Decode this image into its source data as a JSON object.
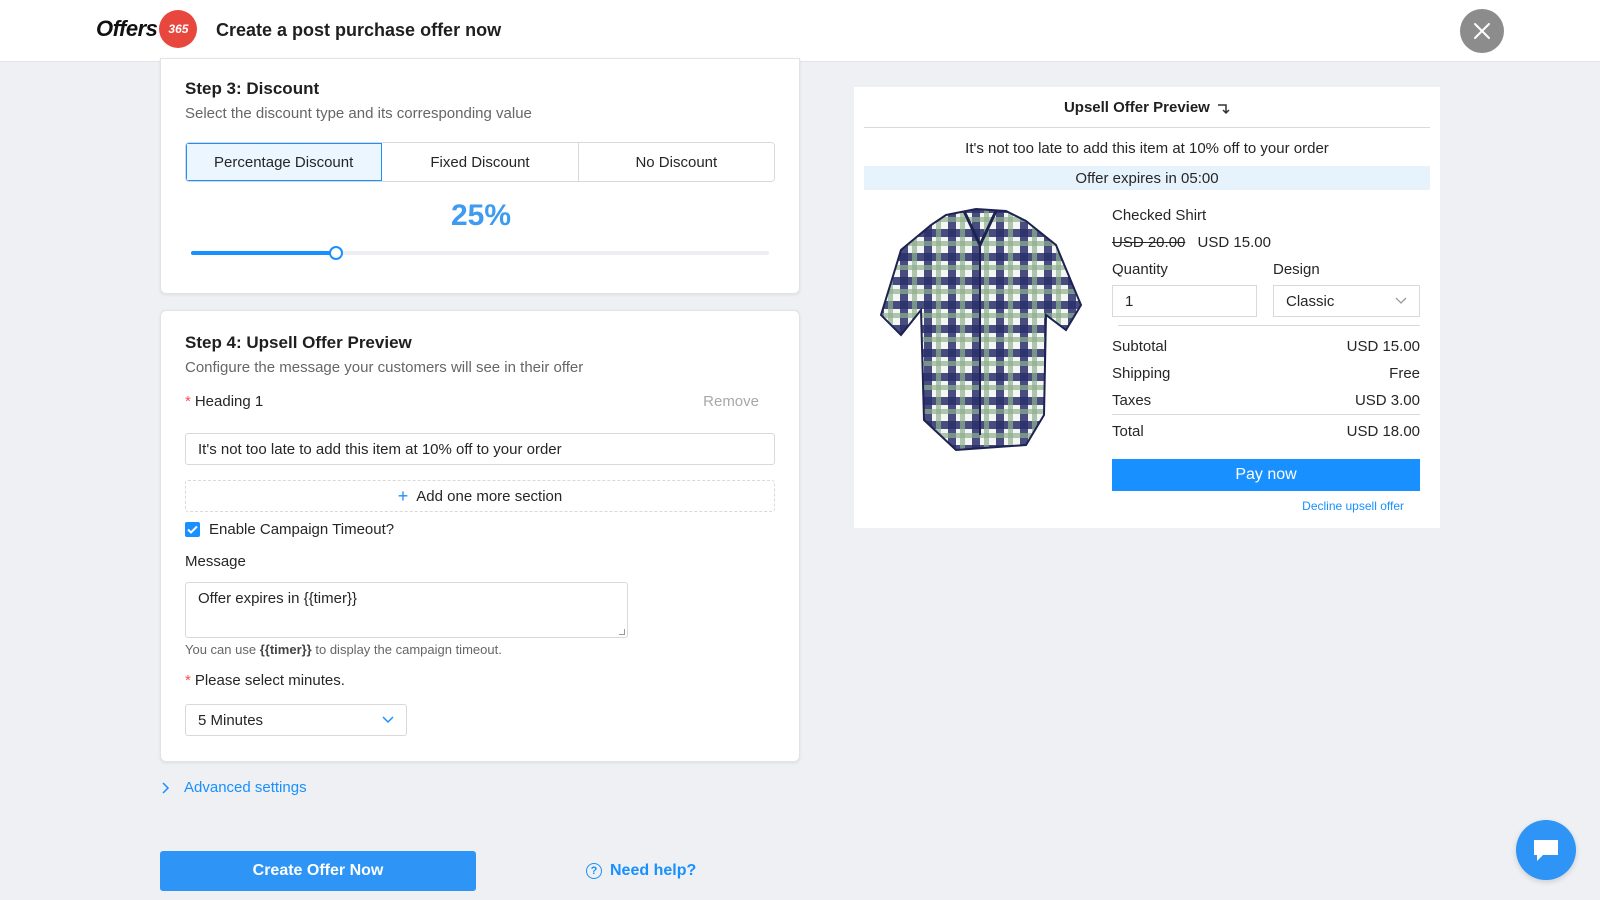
{
  "header": {
    "logo_text": "Offers",
    "logo_badge": "365",
    "title": "Create a post purchase offer now",
    "close_icon": "close-icon"
  },
  "step3": {
    "title": "Step 3: Discount",
    "subtitle": "Select the discount type and its corresponding value",
    "discount_types": [
      "Percentage Discount",
      "Fixed Discount",
      "No Discount"
    ],
    "selected_type": "Percentage Discount",
    "value_display": "25%",
    "slider_fraction": 0.25
  },
  "step4": {
    "title": "Step 4: Upsell Offer Preview",
    "subtitle": "Configure the message your customers will see in their offer",
    "heading_label": "Heading 1",
    "remove_label": "Remove",
    "heading_value": "It's not too late to add this item at 10% off to your order",
    "add_section_label": "Add one more section",
    "timeout_label": "Enable Campaign Timeout?",
    "timeout_checked": true,
    "message_label": "Message",
    "message_value": "Offer expires in {{timer}}",
    "hint_prefix": "You can use",
    "hint_token": "{{timer}}",
    "hint_suffix": "to display the campaign timeout.",
    "minutes_label": "Please select minutes.",
    "minutes_value": "5 Minutes"
  },
  "advanced_settings_label": "Advanced settings",
  "create_button_label": "Create Offer Now",
  "help_label": "Need help?",
  "preview": {
    "title": "Upsell Offer Preview",
    "heading": "It's not too late to add this item at 10% off to your order",
    "timer_text": "Offer expires in 05:00",
    "product_name": "Checked Shirt",
    "original_price": "USD 20.00",
    "sale_price": "USD 15.00",
    "quantity_label": "Quantity",
    "quantity_value": "1",
    "design_label": "Design",
    "design_value": "Classic",
    "subtotal_label": "Subtotal",
    "subtotal_value": "USD 15.00",
    "shipping_label": "Shipping",
    "shipping_value": "Free",
    "taxes_label": "Taxes",
    "taxes_value": "USD 3.00",
    "total_label": "Total",
    "total_value": "USD 18.00",
    "pay_label": "Pay now",
    "decline_label": "Decline upsell offer"
  },
  "colors": {
    "accent": "#1890ff",
    "brand_badge": "#e8473e",
    "required": "#ff4d4f"
  }
}
